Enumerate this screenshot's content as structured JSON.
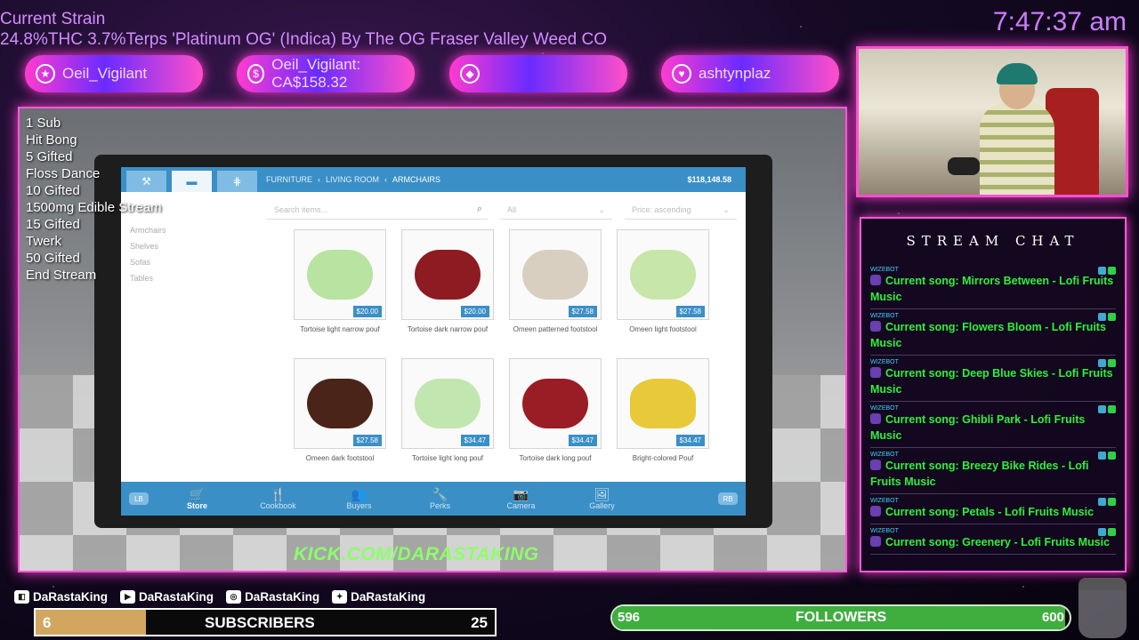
{
  "overlay": {
    "strain_title": "Current Strain",
    "strain_detail": "24.8%THC 3.7%Terps 'Platinum OG' (Indica) By The OG Fraser Valley Weed CO",
    "clock": "7:47:37 am",
    "alerts": [
      {
        "icon": "star-icon",
        "text": "Oeil_Vigilant"
      },
      {
        "icon": "dollar-icon",
        "text": "Oeil_Vigilant: CA$158.32"
      },
      {
        "icon": "diamond-icon",
        "text": ""
      },
      {
        "icon": "heart-icon",
        "text": "ashtynplaz"
      }
    ],
    "goals": [
      "1 Sub",
      "Hit Bong",
      "5 Gifted",
      "Floss Dance",
      "10 Gifted",
      "1500mg Edible Stream",
      "15 Gifted",
      "Twerk",
      "50 Gifted",
      "End Stream"
    ],
    "kick": "KICK.COM/DARASTAKING"
  },
  "game": {
    "tabs": [
      {
        "icon": "hammer-icon",
        "glyph": "⚒"
      },
      {
        "icon": "sofa-icon",
        "glyph": "▬"
      },
      {
        "icon": "fence-icon",
        "glyph": "⋕"
      }
    ],
    "breadcrumb": [
      "FURNITURE",
      "LIVING ROOM",
      "ARMCHAIRS"
    ],
    "money": "$118,148.58",
    "categories": [
      "Armchairs",
      "Shelves",
      "Sofas",
      "Tables"
    ],
    "search_placeholder": "Search items...",
    "filter_all": "All",
    "sort": "Price: ascending",
    "products": [
      {
        "name": "Tortoise light narrow pouf",
        "price": "$20.00",
        "color": "#b8e3a0"
      },
      {
        "name": "Tortoise dark narrow pouf",
        "price": "$20.00",
        "color": "#8e1a22"
      },
      {
        "name": "Omeen patterned footstool",
        "price": "$27.58",
        "color": "#d9cfc0"
      },
      {
        "name": "Omeen light footstool",
        "price": "$27.58",
        "color": "#c6e6aa"
      },
      {
        "name": "Omeen dark footstool",
        "price": "$27.58",
        "color": "#4a2418"
      },
      {
        "name": "Tortoise light long pouf",
        "price": "$34.47",
        "color": "#c2e6b0"
      },
      {
        "name": "Tortoise dark long pouf",
        "price": "$34.47",
        "color": "#9a1c24"
      },
      {
        "name": "Bright-colored Pouf",
        "price": "$34.47",
        "color": "#e8c93a"
      }
    ],
    "bottom_left": "LB",
    "bottom_right": "RB",
    "nav": [
      {
        "label": "Store",
        "icon": "cart-icon",
        "glyph": "🛒"
      },
      {
        "label": "Cookbook",
        "icon": "cutlery-icon",
        "glyph": "🍴"
      },
      {
        "label": "Buyers",
        "icon": "people-icon",
        "glyph": "👥"
      },
      {
        "label": "Perks",
        "icon": "wrench-icon",
        "glyph": "🔧"
      },
      {
        "label": "Camera",
        "icon": "camera-icon",
        "glyph": "📷"
      },
      {
        "label": "Gallery",
        "icon": "image-icon",
        "glyph": "🖼"
      }
    ]
  },
  "chat": {
    "title": "STREAM CHAT",
    "messages": [
      {
        "user": "WIZEBOT",
        "text": "Current song: Mirrors Between - Lofi Fruits Music"
      },
      {
        "user": "WIZEBOT",
        "text": "Current song: Flowers Bloom - Lofi Fruits Music"
      },
      {
        "user": "WIZEBOT",
        "text": "Current song: Deep Blue Skies - Lofi Fruits Music"
      },
      {
        "user": "WIZEBOT",
        "text": "Current song: Ghibli Park - Lofi Fruits Music"
      },
      {
        "user": "WIZEBOT",
        "text": "Current song: Breezy Bike Rides - Lofi Fruits Music"
      },
      {
        "user": "WIZEBOT",
        "text": "Current song: Petals - Lofi Fruits Music"
      },
      {
        "user": "WIZEBOT",
        "text": "Current song: Greenery - Lofi Fruits Music"
      }
    ]
  },
  "socials": [
    {
      "icon": "twitch-icon",
      "name": "DaRastaKing"
    },
    {
      "icon": "youtube-icon",
      "name": "DaRastaKing"
    },
    {
      "icon": "instagram-icon",
      "name": "DaRastaKing"
    },
    {
      "icon": "twitter-icon",
      "name": "DaRastaKing"
    }
  ],
  "subscribers": {
    "label": "SUBSCRIBERS",
    "current": "6",
    "goal": "25",
    "progress": 0.24
  },
  "followers": {
    "label": "FOLLOWERS",
    "current": "596",
    "goal": "600",
    "progress": 0.99
  }
}
